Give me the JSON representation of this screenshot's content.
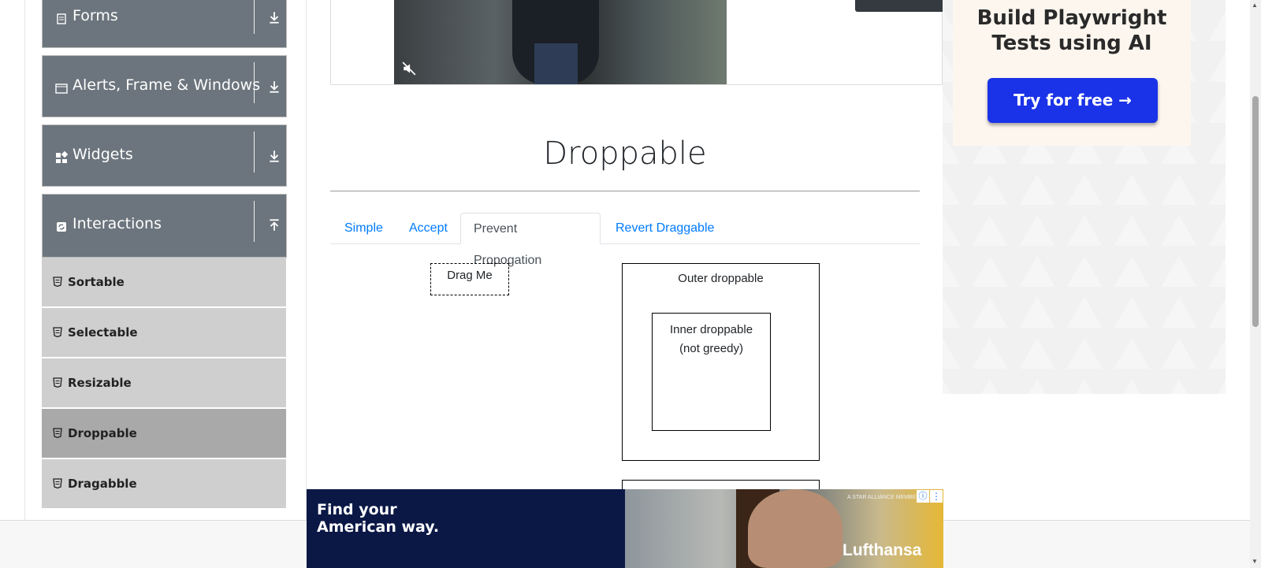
{
  "sidebar": {
    "groups": [
      {
        "label": "Forms",
        "icon": "document-icon",
        "arrow": "download-arrow-icon"
      },
      {
        "label": "Alerts, Frame & Windows",
        "icon": "window-icon",
        "arrow": "download-arrow-icon"
      },
      {
        "label": "Widgets",
        "icon": "widgets-icon",
        "arrow": "download-arrow-icon"
      },
      {
        "label": "Interactions",
        "icon": "refresh-icon",
        "arrow": "upload-arrow-icon"
      }
    ],
    "items": [
      {
        "label": "Sortable",
        "active": false
      },
      {
        "label": "Selectable",
        "active": false
      },
      {
        "label": "Resizable",
        "active": false
      },
      {
        "label": "Droppable",
        "active": true
      },
      {
        "label": "Dragabble",
        "active": false
      }
    ]
  },
  "main": {
    "title": "Droppable",
    "tabs": [
      {
        "label": "Simple",
        "active": false
      },
      {
        "label": "Accept",
        "active": false
      },
      {
        "label": "Prevent Propogation",
        "active": true
      },
      {
        "label": "Revert Draggable",
        "active": false
      }
    ],
    "drag_label": "Drag Me",
    "outer_label": "Outer droppable",
    "inner_label_line1": "Inner droppable",
    "inner_label_line2": "(not greedy)"
  },
  "ad_right": {
    "title_line1": "Build Playwright",
    "title_line2": "Tests using AI",
    "button_label": "Try for free →"
  },
  "banner": {
    "line1": "Find your",
    "line2": "American way.",
    "brand": "Lufthansa",
    "tagline": "A STAR ALLIANCE MEMBER",
    "info_icon": "info-icon",
    "more_icon": "more-vertical-icon"
  },
  "colors": {
    "sidebar_group": "#6c757d",
    "sidebar_item": "#cfcfcf",
    "sidebar_item_active": "#a9a9a9",
    "tab_link": "#007bff",
    "ad_button": "#1a32e8",
    "banner_bg": "#0b1846"
  }
}
